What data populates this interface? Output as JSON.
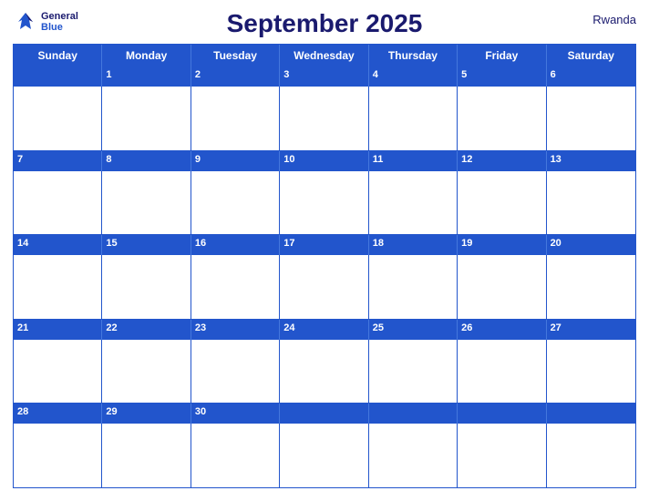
{
  "header": {
    "title": "September 2025",
    "country": "Rwanda",
    "logo": {
      "general": "General",
      "blue": "Blue"
    }
  },
  "days": {
    "headers": [
      "Sunday",
      "Monday",
      "Tuesday",
      "Wednesday",
      "Thursday",
      "Friday",
      "Saturday"
    ]
  },
  "weeks": [
    [
      null,
      1,
      2,
      3,
      4,
      5,
      6
    ],
    [
      7,
      8,
      9,
      10,
      11,
      12,
      13
    ],
    [
      14,
      15,
      16,
      17,
      18,
      19,
      20
    ],
    [
      21,
      22,
      23,
      24,
      25,
      26,
      27
    ],
    [
      28,
      29,
      30,
      null,
      null,
      null,
      null
    ]
  ]
}
